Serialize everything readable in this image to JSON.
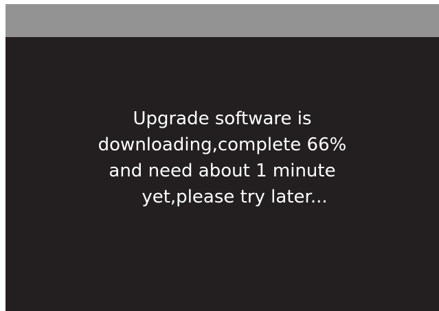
{
  "colors": {
    "title_bar": "#939393",
    "background": "#231f20",
    "text": "#ffffff"
  },
  "message": {
    "line_1": "Upgrade software is",
    "line_2": "downloading,complete 66%",
    "line_3": "and need about 1 minute",
    "line_4": "yet,please try later..."
  },
  "progress": {
    "percent": 66,
    "remaining": "1 minute"
  }
}
